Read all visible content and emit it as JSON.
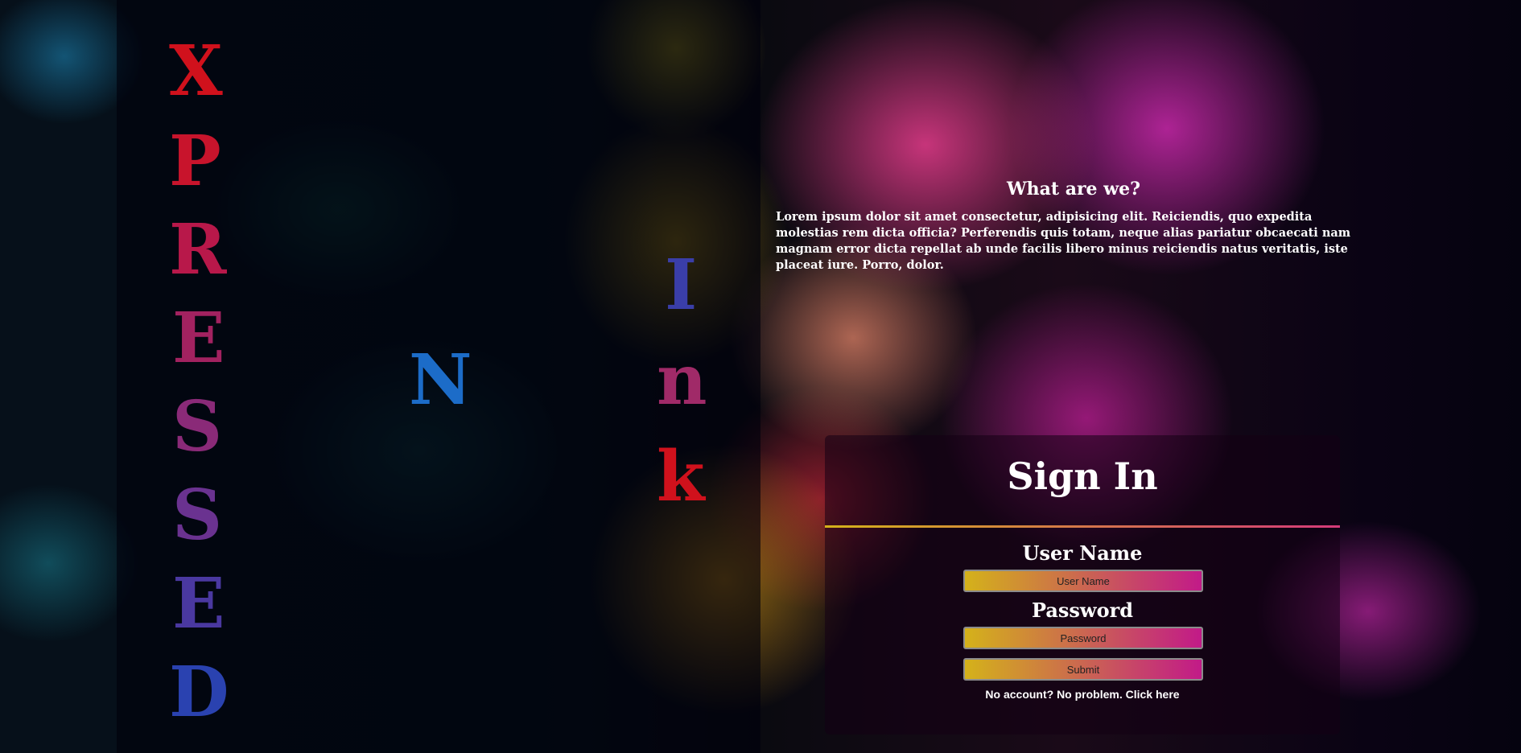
{
  "brand": {
    "vertical_word": [
      "X",
      "P",
      "R",
      "E",
      "S",
      "S",
      "E",
      "D"
    ],
    "n_letter": "N",
    "ink_letters": [
      "I",
      "n",
      "k"
    ]
  },
  "about": {
    "title": "What are we?",
    "text": "Lorem ipsum dolor sit amet consectetur, adipisicing elit. Reiciendis, quo expedita molestias rem dicta officia? Perferendis quis totam, neque alias pariatur obcaecati nam magnam error dicta repellat ab unde facilis libero minus reiciendis natus veritatis, iste placeat iure. Porro, dolor."
  },
  "signin": {
    "title": "Sign In",
    "username_label": "User Name",
    "username_placeholder": "User Name",
    "password_label": "Password",
    "password_placeholder": "Password",
    "submit_label": "Submit",
    "register_prefix": "No account? No problem. ",
    "register_link": "Click here"
  },
  "colors": {
    "gradient_start": "#d4b21a",
    "gradient_end": "#c21a88",
    "brand_red": "#d0111c",
    "brand_blue": "#1c6cc8"
  }
}
